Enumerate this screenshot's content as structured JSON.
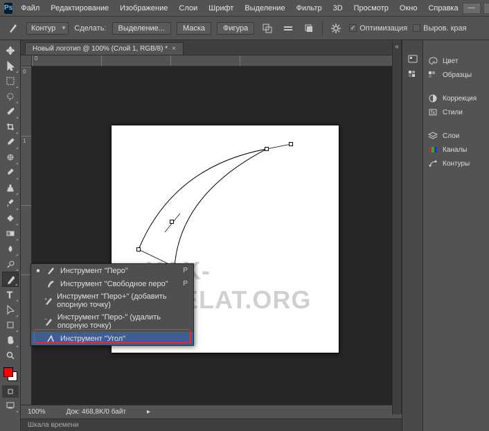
{
  "app": {
    "logo_text": "Ps"
  },
  "menubar": [
    "Файл",
    "Редактирование",
    "Изображение",
    "Слои",
    "Шрифт",
    "Выделение",
    "Фильтр",
    "3D",
    "Просмотр",
    "Окно",
    "Справка"
  ],
  "win_controls": {
    "min": "—",
    "max": "□",
    "close": "✕"
  },
  "options": {
    "path_label": "Контур",
    "make_label": "Сделать:",
    "selection_btn": "Выделение...",
    "mask_btn": "Маска",
    "shape_btn": "Фигура",
    "opt_checkbox_label": "Оптимизация",
    "trim_edges_label": "Выров. края"
  },
  "document": {
    "tab_title": "Новый логотип @ 100% (Слой 1, RGB/8) *",
    "zoom": "100%",
    "doc_info": "Док: 468,8K/0 байт",
    "timeline_label": "Шкала времени",
    "ruler_h": [
      "0",
      "",
      "",
      ""
    ],
    "ruler_v": [
      "0",
      "1",
      "",
      ""
    ]
  },
  "watermark": "KAK-SDELAT.ORG",
  "flyout": {
    "items": [
      {
        "label": "Инструмент \"Перо\"",
        "shortcut": "P",
        "marked": true
      },
      {
        "label": "Инструмент \"Свободное перо\"",
        "shortcut": "P",
        "marked": false
      },
      {
        "label": "Инструмент \"Перо+\" (добавить опорную точку)",
        "shortcut": "",
        "marked": false
      },
      {
        "label": "Инструмент \"Перо-\" (удалить опорную точку)",
        "shortcut": "",
        "marked": false
      },
      {
        "label": "Инструмент \"Угол\"",
        "shortcut": "",
        "marked": false
      }
    ],
    "selected_index": 4
  },
  "panels": {
    "group1": [
      "Цвет",
      "Образцы"
    ],
    "group2": [
      "Коррекция",
      "Стили"
    ],
    "group3": [
      "Слои",
      "Каналы",
      "Контуры"
    ]
  },
  "icons": {
    "palette": "palette-icon",
    "swatches": "swatches-icon",
    "adjust": "adjust-icon",
    "styles": "styles-icon",
    "layers": "layers-icon",
    "channels": "channels-icon",
    "paths": "paths-icon"
  }
}
